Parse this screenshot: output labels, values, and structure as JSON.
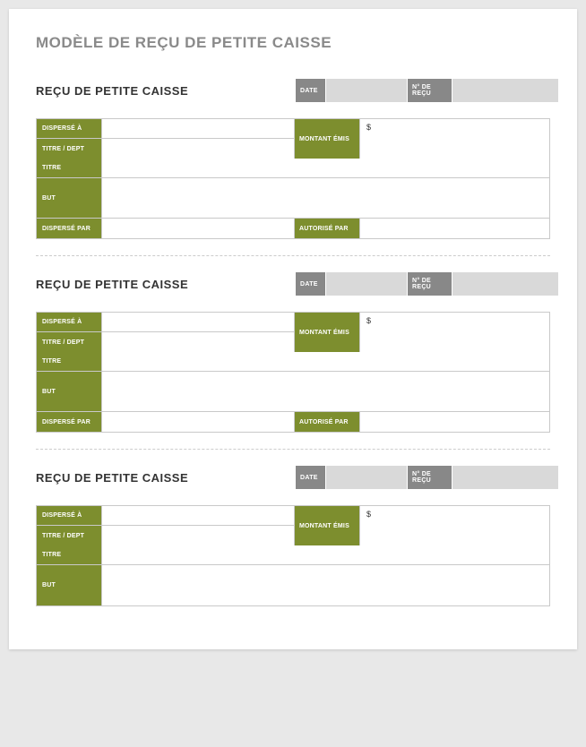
{
  "mainTitle": "MODÈLE DE REÇU DE PETITE CAISSE",
  "labels": {
    "receiptTitle": "REÇU DE PETITE CAISSE",
    "date": "DATE",
    "receiptNo": "N° DE REÇU",
    "dispersedTo": "DISPERSÉ À",
    "titleDept": "TITRE / DEPT",
    "title": "TITRE",
    "purpose": "BUT",
    "dispersedBy": "DISPERSÉ PAR",
    "amountIssued": "MONTANT ÉMIS",
    "authorizedBy": "AUTORISÉ PAR",
    "currency": "$"
  },
  "receipts": [
    {
      "date": "",
      "number": "",
      "dispersedTo": "",
      "titleDept": "",
      "title": "",
      "purpose": "",
      "dispersedBy": "",
      "authorizedBy": "",
      "amount": ""
    },
    {
      "date": "",
      "number": "",
      "dispersedTo": "",
      "titleDept": "",
      "title": "",
      "purpose": "",
      "dispersedBy": "",
      "authorizedBy": "",
      "amount": ""
    },
    {
      "date": "",
      "number": "",
      "dispersedTo": "",
      "titleDept": "",
      "title": "",
      "purpose": "",
      "dispersedBy": "",
      "authorizedBy": "",
      "amount": ""
    }
  ]
}
